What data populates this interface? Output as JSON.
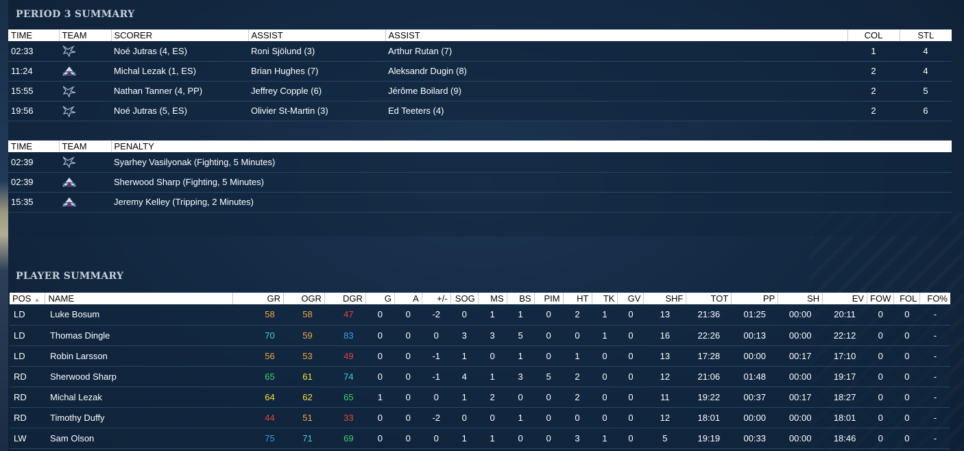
{
  "period_summary": {
    "title": "PERIOD 3 SUMMARY",
    "goals": {
      "headers": [
        "TIME",
        "TEAM",
        "SCORER",
        "ASSIST",
        "ASSIST",
        "COL",
        "STL"
      ],
      "rows": [
        {
          "time": "02:33",
          "team": "blues-logo-icon",
          "scorer": "Noé Jutras (4, ES)",
          "assist1": "Roni Sjölund (3)",
          "assist2": "Arthur Rutan (7)",
          "col": "1",
          "stl": "4"
        },
        {
          "time": "11:24",
          "team": "avalanche-logo-icon",
          "scorer": "Michal Lezak (1, ES)",
          "assist1": "Brian Hughes (7)",
          "assist2": "Aleksandr Dugin (8)",
          "col": "2",
          "stl": "4"
        },
        {
          "time": "15:55",
          "team": "blues-logo-icon",
          "scorer": "Nathan Tanner (4, PP)",
          "assist1": "Jeffrey Copple (6)",
          "assist2": "Jérôme Boilard (9)",
          "col": "2",
          "stl": "5"
        },
        {
          "time": "19:56",
          "team": "blues-logo-icon",
          "scorer": "Noé Jutras (5, ES)",
          "assist1": "Olivier St-Martin (3)",
          "assist2": "Ed Teeters (4)",
          "col": "2",
          "stl": "6"
        }
      ]
    },
    "penalties": {
      "headers": [
        "TIME",
        "TEAM",
        "PENALTY"
      ],
      "rows": [
        {
          "time": "02:39",
          "team": "blues-logo-icon",
          "penalty": "Syarhey Vasilyonak (Fighting, 5 Minutes)"
        },
        {
          "time": "02:39",
          "team": "avalanche-logo-icon",
          "penalty": "Sherwood Sharp (Fighting, 5 Minutes)"
        },
        {
          "time": "15:35",
          "team": "avalanche-logo-icon",
          "penalty": "Jeremy Kelley (Tripping, 2 Minutes)"
        }
      ]
    }
  },
  "player_summary": {
    "title": "PLAYER SUMMARY",
    "sort_indicator": "▲",
    "headers": [
      "POS",
      "NAME",
      "GR",
      "OGR",
      "DGR",
      "G",
      "A",
      "+/-",
      "SOG",
      "MS",
      "BS",
      "PIM",
      "HT",
      "TK",
      "GV",
      "SHF",
      "TOT",
      "PP",
      "SH",
      "EV",
      "FOW",
      "FOL",
      "FO%"
    ],
    "rating_colors": {
      "orange": "#f5a443",
      "red": "#e6423a",
      "teal": "#3fd1d6",
      "blue": "#3b9cf0",
      "green": "#3bd36a",
      "yellow": "#f3e53b",
      "light_green": "#7fdc6a"
    },
    "rows": [
      {
        "pos": "LD",
        "name": "Luke Bosum",
        "gr": "58",
        "gr_c": "orange",
        "ogr": "58",
        "ogr_c": "orange",
        "dgr": "47",
        "dgr_c": "red",
        "g": "0",
        "a": "0",
        "pm": "-2",
        "sog": "0",
        "ms": "1",
        "bs": "1",
        "pim": "0",
        "ht": "2",
        "tk": "1",
        "gv": "0",
        "shf": "13",
        "tot": "21:36",
        "pp": "01:25",
        "sh": "00:00",
        "ev": "20:11",
        "fow": "0",
        "fol": "0",
        "fop": "-"
      },
      {
        "pos": "LD",
        "name": "Thomas Dingle",
        "gr": "70",
        "gr_c": "teal",
        "ogr": "59",
        "ogr_c": "orange",
        "dgr": "83",
        "dgr_c": "blue",
        "g": "0",
        "a": "0",
        "pm": "0",
        "sog": "3",
        "ms": "3",
        "bs": "5",
        "pim": "0",
        "ht": "0",
        "tk": "1",
        "gv": "0",
        "shf": "16",
        "tot": "22:26",
        "pp": "00:13",
        "sh": "00:00",
        "ev": "22:12",
        "fow": "0",
        "fol": "0",
        "fop": "-"
      },
      {
        "pos": "LD",
        "name": "Robin Larsson",
        "gr": "56",
        "gr_c": "orange",
        "ogr": "53",
        "ogr_c": "orange",
        "dgr": "49",
        "dgr_c": "red",
        "g": "0",
        "a": "0",
        "pm": "-1",
        "sog": "1",
        "ms": "0",
        "bs": "1",
        "pim": "0",
        "ht": "1",
        "tk": "0",
        "gv": "0",
        "shf": "13",
        "tot": "17:28",
        "pp": "00:00",
        "sh": "00:17",
        "ev": "17:10",
        "fow": "0",
        "fol": "0",
        "fop": "-"
      },
      {
        "pos": "RD",
        "name": "Sherwood Sharp",
        "gr": "65",
        "gr_c": "green",
        "ogr": "61",
        "ogr_c": "yellow",
        "dgr": "74",
        "dgr_c": "teal",
        "g": "0",
        "a": "0",
        "pm": "-1",
        "sog": "4",
        "ms": "1",
        "bs": "3",
        "pim": "5",
        "ht": "2",
        "tk": "0",
        "gv": "0",
        "shf": "12",
        "tot": "21:06",
        "pp": "01:48",
        "sh": "00:00",
        "ev": "19:17",
        "fow": "0",
        "fol": "0",
        "fop": "-"
      },
      {
        "pos": "RD",
        "name": "Michal Lezak",
        "gr": "64",
        "gr_c": "yellow",
        "ogr": "62",
        "ogr_c": "yellow",
        "dgr": "65",
        "dgr_c": "green",
        "g": "1",
        "a": "0",
        "pm": "0",
        "sog": "1",
        "ms": "2",
        "bs": "0",
        "pim": "0",
        "ht": "2",
        "tk": "0",
        "gv": "0",
        "shf": "11",
        "tot": "19:22",
        "pp": "00:37",
        "sh": "00:17",
        "ev": "18:27",
        "fow": "0",
        "fol": "0",
        "fop": "-"
      },
      {
        "pos": "RD",
        "name": "Timothy Duffy",
        "gr": "44",
        "gr_c": "red",
        "ogr": "51",
        "ogr_c": "orange",
        "dgr": "33",
        "dgr_c": "red",
        "g": "0",
        "a": "0",
        "pm": "-2",
        "sog": "0",
        "ms": "0",
        "bs": "1",
        "pim": "0",
        "ht": "0",
        "tk": "0",
        "gv": "0",
        "shf": "12",
        "tot": "18:01",
        "pp": "00:00",
        "sh": "00:00",
        "ev": "18:01",
        "fow": "0",
        "fol": "0",
        "fop": "-"
      },
      {
        "pos": "LW",
        "name": "Sam Olson",
        "gr": "75",
        "gr_c": "blue",
        "ogr": "71",
        "ogr_c": "teal",
        "dgr": "69",
        "dgr_c": "green",
        "g": "0",
        "a": "0",
        "pm": "0",
        "sog": "1",
        "ms": "1",
        "bs": "0",
        "pim": "0",
        "ht": "3",
        "tk": "1",
        "gv": "0",
        "shf": "5",
        "tot": "19:19",
        "pp": "00:33",
        "sh": "00:00",
        "ev": "18:46",
        "fow": "0",
        "fol": "0",
        "fop": "-"
      }
    ]
  },
  "colors": {
    "background": "#0f2238",
    "header_bg": "#ffffff",
    "section_title": "#c7d0dc"
  }
}
